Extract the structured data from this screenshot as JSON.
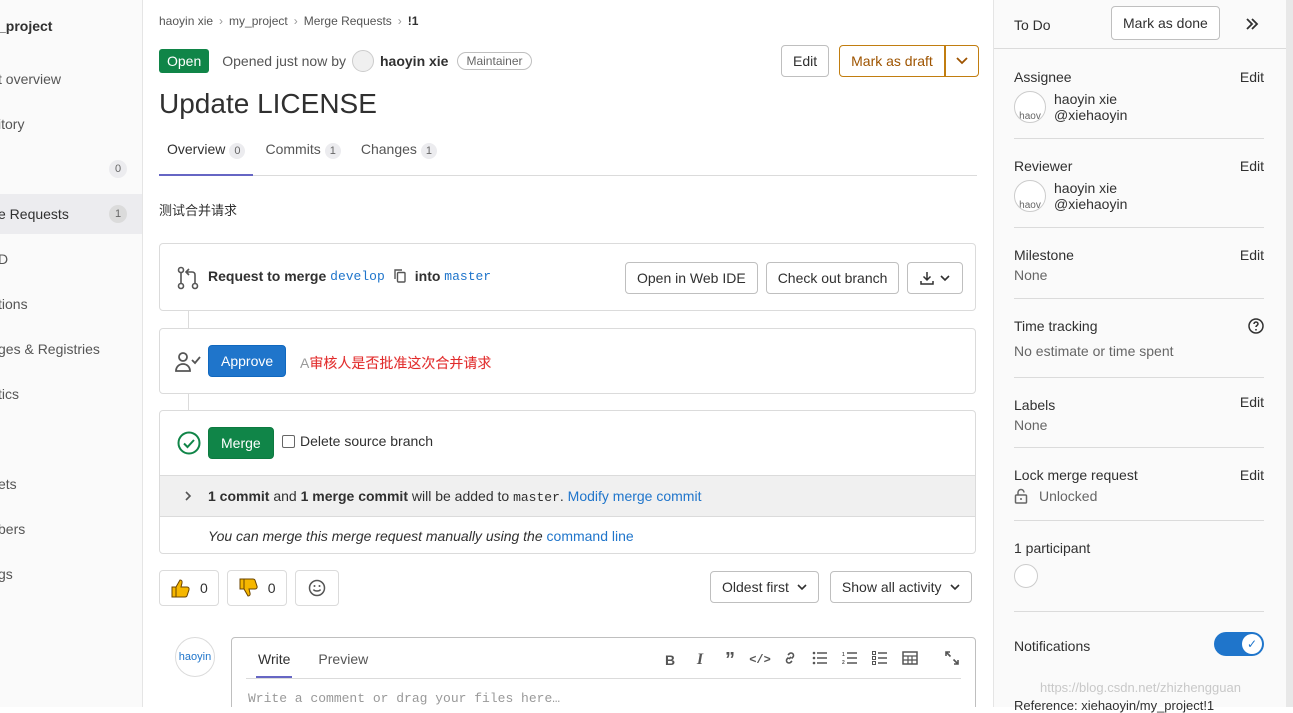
{
  "left_nav": {
    "project": "_project",
    "items": [
      {
        "label": "t overview",
        "count": ""
      },
      {
        "label": "itory",
        "count": ""
      },
      {
        "label": "",
        "count": "0"
      },
      {
        "label": "e Requests",
        "count": "1"
      },
      {
        "label": "D",
        "count": ""
      },
      {
        "label": "tions",
        "count": ""
      },
      {
        "label": "ges & Registries",
        "count": ""
      },
      {
        "label": "tics",
        "count": ""
      },
      {
        "label": "",
        "count": ""
      },
      {
        "label": "ets",
        "count": ""
      },
      {
        "label": "bers",
        "count": ""
      },
      {
        "label": "gs",
        "count": ""
      }
    ]
  },
  "breadcrumb": {
    "user": "haoyin xie",
    "project": "my_project",
    "section": "Merge Requests",
    "current": "!1"
  },
  "header": {
    "status": "Open",
    "opened_text": "Opened just now by",
    "author": "haoyin xie",
    "role": "Maintainer",
    "edit_label": "Edit",
    "draft_label": "Mark as draft"
  },
  "title": "Update LICENSE",
  "tabs": [
    {
      "label": "Overview",
      "count": "0"
    },
    {
      "label": "Commits",
      "count": "1"
    },
    {
      "label": "Changes",
      "count": "1"
    }
  ],
  "description": "测试合并请求",
  "merge_request": {
    "request_label": "Request to merge",
    "source": "develop",
    "into_label": "into",
    "target": "master",
    "web_ide": "Open in Web IDE",
    "checkout": "Check out branch"
  },
  "approval": {
    "button": "Approve",
    "prefix": "A",
    "note": "审核人是否批准这次合并请求"
  },
  "merge": {
    "button": "Merge",
    "delete_source": "Delete source branch",
    "commit_count": "1 commit",
    "and": "and",
    "merge_commit": "1 merge commit",
    "added_to": "will be added to",
    "branch": "master",
    "period": ".",
    "modify": "Modify merge commit",
    "manual_text": "You can merge this merge request manually using the",
    "command_line": "command line"
  },
  "reactions": {
    "thumbs_up": "0",
    "thumbs_down": "0"
  },
  "sort": {
    "order": "Oldest first",
    "filter": "Show all activity"
  },
  "comment": {
    "avatar_alt": "haoyin",
    "write_tab": "Write",
    "preview_tab": "Preview",
    "placeholder": "Write a comment or drag your files here…"
  },
  "sidebar": {
    "todo": "To Do",
    "mark_done": "Mark as done",
    "edit": "Edit",
    "assignee_label": "Assignee",
    "assignee_name": "haoyin xie",
    "assignee_handle": "@xiehaoyin",
    "reviewer_label": "Reviewer",
    "reviewer_name": "haoyin xie",
    "reviewer_handle": "@xiehaoyin",
    "avatar_alt": "haov",
    "milestone_label": "Milestone",
    "milestone_value": "None",
    "time_label": "Time tracking",
    "time_value": "No estimate or time spent",
    "labels_label": "Labels",
    "labels_value": "None",
    "lock_label": "Lock merge request",
    "lock_value": "Unlocked",
    "participants_label": "1 participant",
    "notifications_label": "Notifications",
    "notifications_on": true,
    "reference_partial": "Reference: xiehaoyin/my_project!1"
  },
  "watermark": "https://blog.csdn.net/zhizhengguan",
  "colors": {
    "accent": "#1f75cb",
    "success": "#108548",
    "warning": "#c17d10",
    "tab_underline": "#6666c4"
  }
}
